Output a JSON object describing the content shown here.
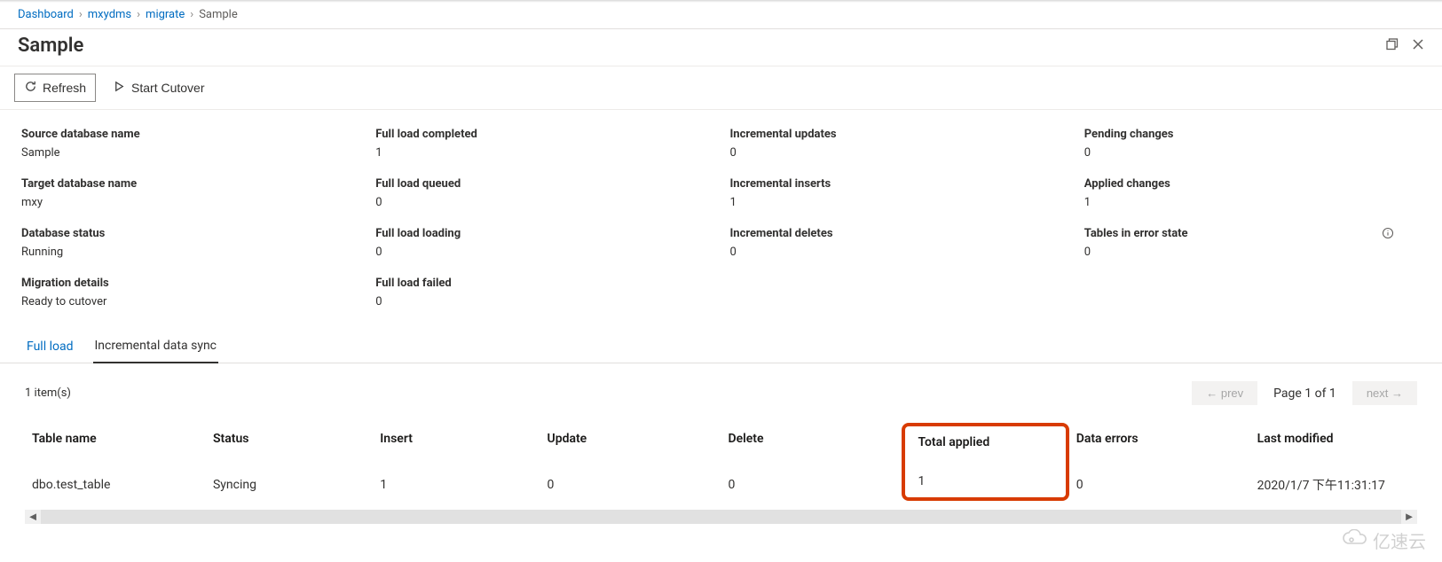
{
  "breadcrumb": {
    "items": [
      "Dashboard",
      "mxydms",
      "migrate",
      "Sample"
    ]
  },
  "header": {
    "title": "Sample"
  },
  "toolbar": {
    "refresh": "Refresh",
    "start_cutover": "Start Cutover"
  },
  "details": {
    "col1": [
      {
        "label": "Source database name",
        "value": "Sample"
      },
      {
        "label": "Target database name",
        "value": "mxy"
      },
      {
        "label": "Database status",
        "value": "Running"
      },
      {
        "label": "Migration details",
        "value": "Ready to cutover"
      }
    ],
    "col2": [
      {
        "label": "Full load completed",
        "value": "1"
      },
      {
        "label": "Full load queued",
        "value": "0"
      },
      {
        "label": "Full load loading",
        "value": "0"
      },
      {
        "label": "Full load failed",
        "value": "0"
      }
    ],
    "col3": [
      {
        "label": "Incremental updates",
        "value": "0"
      },
      {
        "label": "Incremental inserts",
        "value": "1"
      },
      {
        "label": "Incremental deletes",
        "value": "0"
      }
    ],
    "col4": [
      {
        "label": "Pending changes",
        "value": "0"
      },
      {
        "label": "Applied changes",
        "value": "1"
      },
      {
        "label": "Tables in error state",
        "value": "0",
        "info": true
      }
    ]
  },
  "tabs": {
    "items": [
      "Full load",
      "Incremental data sync"
    ],
    "active": 1
  },
  "list": {
    "count_text": "1 item(s)",
    "prev": "← prev",
    "next": "next →",
    "page_of": "Page 1 of 1",
    "columns": [
      "Table name",
      "Status",
      "Insert",
      "Update",
      "Delete",
      "Total applied",
      "Data errors",
      "Last modified"
    ],
    "rows": [
      {
        "table_name": "dbo.test_table",
        "status": "Syncing",
        "insert": "1",
        "update": "0",
        "delete": "0",
        "total_applied": "1",
        "data_errors": "0",
        "last_modified": "2020/1/7 下午11:31:17"
      }
    ],
    "highlight_column": "Total applied"
  },
  "watermark": "亿速云"
}
